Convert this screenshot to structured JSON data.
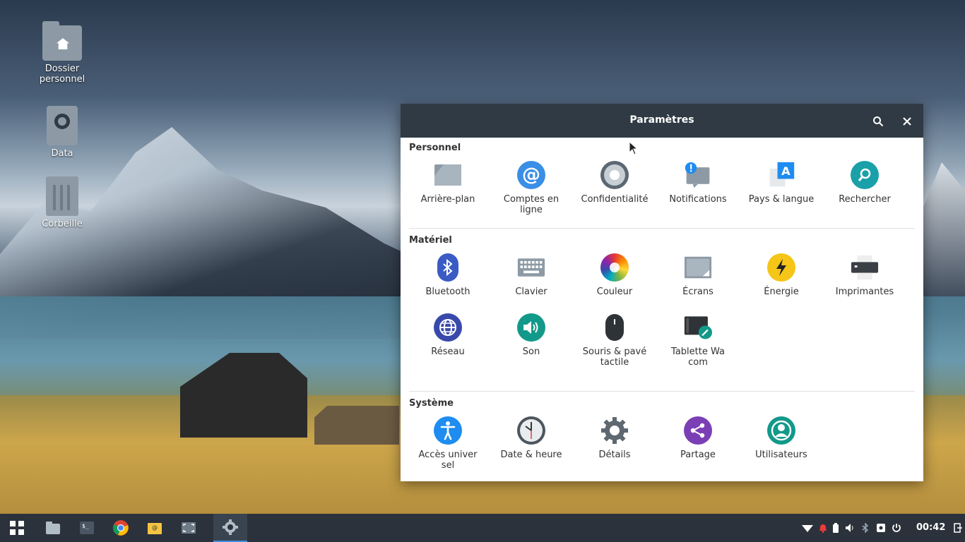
{
  "desktop": {
    "icons": [
      {
        "label": "Dossier\npersonnel",
        "icon": "home-folder-icon"
      },
      {
        "label": "Data",
        "icon": "drive-icon"
      },
      {
        "label": "Corbeille",
        "icon": "trash-icon"
      }
    ]
  },
  "window": {
    "title": "Paramètres",
    "sections": {
      "personnel": {
        "title": "Personnel",
        "items": [
          {
            "label": "Arrière-plan",
            "icon": "background-icon"
          },
          {
            "label": "Comptes en\nligne",
            "icon": "online-accounts-icon"
          },
          {
            "label": "Confidentialité",
            "icon": "privacy-icon"
          },
          {
            "label": "Notifications",
            "icon": "notifications-icon"
          },
          {
            "label": "Pays & langue",
            "icon": "region-language-icon"
          },
          {
            "label": "Rechercher",
            "icon": "search-icon"
          }
        ]
      },
      "materiel": {
        "title": "Matériel",
        "items": [
          {
            "label": "Bluetooth",
            "icon": "bluetooth-icon"
          },
          {
            "label": "Clavier",
            "icon": "keyboard-icon"
          },
          {
            "label": "Couleur",
            "icon": "color-icon"
          },
          {
            "label": "Écrans",
            "icon": "display-icon"
          },
          {
            "label": "Énergie",
            "icon": "power-icon"
          },
          {
            "label": "Imprimantes",
            "icon": "printer-icon"
          },
          {
            "label": "Réseau",
            "icon": "network-icon"
          },
          {
            "label": "Son",
            "icon": "sound-icon"
          },
          {
            "label": "Souris & pavé\ntactile",
            "icon": "mouse-icon"
          },
          {
            "label": "Tablette Wa\ncom",
            "icon": "wacom-tablet-icon"
          }
        ]
      },
      "systeme": {
        "title": "Système",
        "items": [
          {
            "label": "Accès univer\nsel",
            "icon": "accessibility-icon"
          },
          {
            "label": "Date & heure",
            "icon": "clock-icon"
          },
          {
            "label": "Détails",
            "icon": "gear-icon"
          },
          {
            "label": "Partage",
            "icon": "share-icon"
          },
          {
            "label": "Utilisateurs",
            "icon": "user-icon"
          }
        ]
      }
    }
  },
  "taskbar": {
    "clock": "00:42",
    "apps": [
      "apps-grid-icon",
      "file-manager-icon",
      "terminal-icon",
      "chrome-icon",
      "mail-icon",
      "screenshot-icon",
      "settings-icon"
    ]
  },
  "colors": {
    "titlebar": "#2f3a44",
    "taskbar": "#2b323b",
    "accent": "#3d8fe0"
  }
}
